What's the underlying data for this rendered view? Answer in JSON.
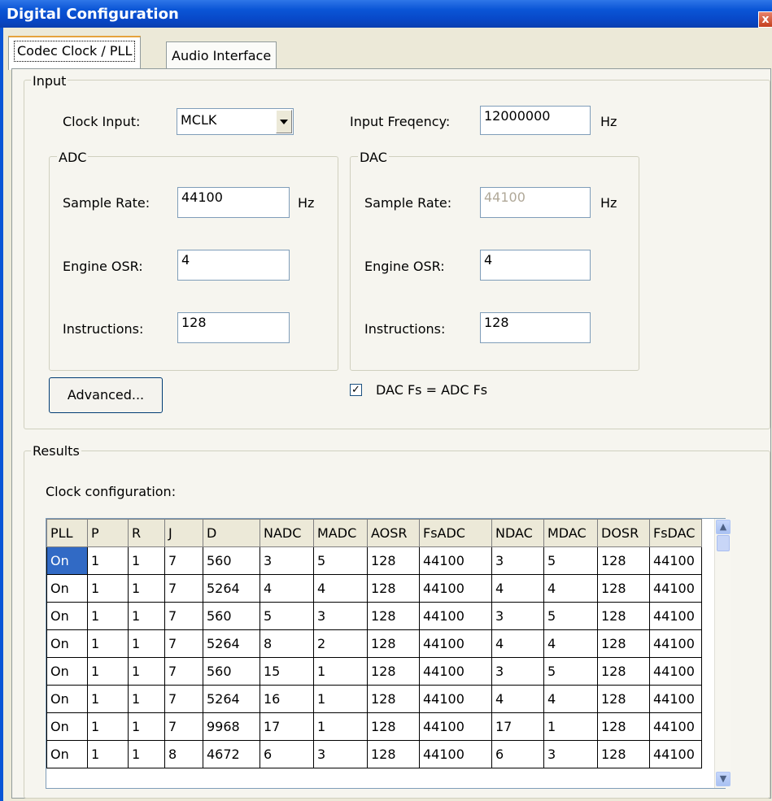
{
  "window": {
    "title": "Digital Configuration",
    "close_glyph": "x"
  },
  "tabs": [
    {
      "label": "Codec Clock / PLL",
      "active": true
    },
    {
      "label": "Audio Interface",
      "active": false
    }
  ],
  "input": {
    "legend": "Input",
    "clock_input": {
      "label": "Clock Input:",
      "value": "MCLK"
    },
    "input_frequency": {
      "label": "Input Freqency:",
      "value": "12000000",
      "unit": "Hz"
    },
    "adc": {
      "legend": "ADC",
      "sample_rate": {
        "label": "Sample Rate:",
        "value": "44100",
        "unit": "Hz"
      },
      "engine_osr": {
        "label": "Engine OSR:",
        "value": "4"
      },
      "instructions": {
        "label": "Instructions:",
        "value": "128"
      }
    },
    "dac": {
      "legend": "DAC",
      "sample_rate": {
        "label": "Sample Rate:",
        "value": "44100",
        "unit": "Hz"
      },
      "engine_osr": {
        "label": "Engine OSR:",
        "value": "4"
      },
      "instructions": {
        "label": "Instructions:",
        "value": "128"
      }
    },
    "advanced_button": "Advanced...",
    "dac_fs_checkbox": {
      "label": "DAC Fs = ADC Fs",
      "checked": true,
      "mark": "✓"
    }
  },
  "results": {
    "legend": "Results",
    "clock_config_label": "Clock configuration:",
    "columns": [
      "PLL",
      "P",
      "R",
      "J",
      "D",
      "NADC",
      "MADC",
      "AOSR",
      "FsADC",
      "NDAC",
      "MDAC",
      "DOSR",
      "FsDAC"
    ],
    "rows": [
      [
        "On",
        "1",
        "1",
        "7",
        "560",
        "3",
        "5",
        "128",
        "44100",
        "3",
        "5",
        "128",
        "44100"
      ],
      [
        "On",
        "1",
        "1",
        "7",
        "5264",
        "4",
        "4",
        "128",
        "44100",
        "4",
        "4",
        "128",
        "44100"
      ],
      [
        "On",
        "1",
        "1",
        "7",
        "560",
        "5",
        "3",
        "128",
        "44100",
        "3",
        "5",
        "128",
        "44100"
      ],
      [
        "On",
        "1",
        "1",
        "7",
        "5264",
        "8",
        "2",
        "128",
        "44100",
        "4",
        "4",
        "128",
        "44100"
      ],
      [
        "On",
        "1",
        "1",
        "7",
        "560",
        "15",
        "1",
        "128",
        "44100",
        "3",
        "5",
        "128",
        "44100"
      ],
      [
        "On",
        "1",
        "1",
        "7",
        "5264",
        "16",
        "1",
        "128",
        "44100",
        "4",
        "4",
        "128",
        "44100"
      ],
      [
        "On",
        "1",
        "1",
        "7",
        "9968",
        "17",
        "1",
        "128",
        "44100",
        "17",
        "1",
        "128",
        "44100"
      ],
      [
        "On",
        "1",
        "1",
        "8",
        "4672",
        "6",
        "3",
        "128",
        "44100",
        "6",
        "3",
        "128",
        "44100"
      ]
    ],
    "selected_row": 0
  },
  "icons": {
    "scroll_up": "chevron-up-icon",
    "scroll_down": "chevron-down-icon",
    "dropdown": "dropdown-arrow-icon"
  }
}
